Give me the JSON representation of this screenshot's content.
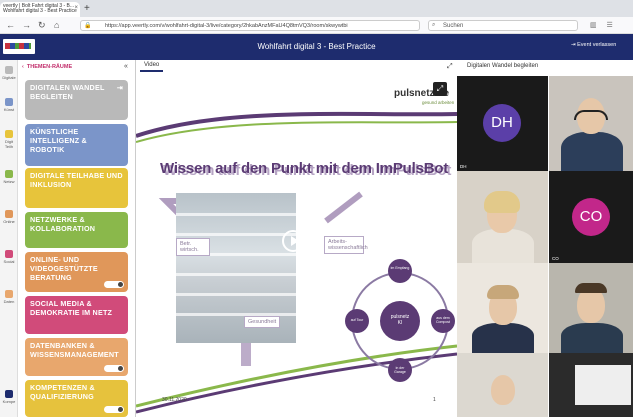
{
  "browser": {
    "tab_title": "veertly | Bolt Fahrt digital 3 - B... Wohlfahrt digital 3 - Best Practice",
    "tab_close": "×",
    "new_tab": "+",
    "url": "https://app.veertly.com/v/wohlfahrt-digital-3/live/category/2hkabAnzMFaU4Q8tmVQ3/room/skwywtbi",
    "search_placeholder": "Suchen"
  },
  "app": {
    "title": "Wohlfahrt digital 3 - Best Practice",
    "exit_label": "Event verlassen"
  },
  "sidebar": {
    "header": "THEMEN-RÄUME",
    "collapse": "«",
    "icon_items": [
      "Digitale",
      "Künst",
      "Digit Teilh",
      "Netzw",
      "Online",
      "Social",
      "Daten",
      "Kompe"
    ],
    "cards": [
      {
        "label": "DIGITALEN WANDEL BEGLEITEN",
        "color": "#b9b9b9"
      },
      {
        "label": "KÜNSTLICHE INTELLIGENZ & ROBOTIK",
        "color": "#7b95c9"
      },
      {
        "label": "DIGITALE TEILHABE UND INKLUSION",
        "color": "#e7c43b"
      },
      {
        "label": "NETZWERKE & KOLLABORATION",
        "color": "#8ab84b"
      },
      {
        "label": "ONLINE- UND VIDEOGESTÜTZTE BERATUNG",
        "color": "#e0975a"
      },
      {
        "label": "SOCIAL MEDIA & DEMOKRATIE IM NETZ",
        "color": "#d14b7a"
      },
      {
        "label": "DATENBANKEN & WISSENSMANAGEMENT",
        "color": "#e8a76d"
      },
      {
        "label": "KOMPETENZEN & QUALIFIZIERUNG",
        "color": "#e6c23d"
      }
    ]
  },
  "main": {
    "video_tab": "Video",
    "right_tab": "Digitalen Wandel begleiten"
  },
  "slide": {
    "title": "Wissen auf den Punkt mit dem ImPulsBot",
    "title_ghost": "Wissen auf den Punkt mit dem ImPulsBot",
    "logo": "pulsnetz.de",
    "logo_sub": "gesund arbeiten",
    "label_left": "Betr. wirtsch.",
    "label_right": "Arbeits- wissenschaftlich",
    "label_bottom": "Gesundheit",
    "center_node": "pulsnetz KI",
    "nodes": [
      "im Empfang",
      "aus dem Compost",
      "in der Garage",
      "auf Tour"
    ],
    "date": "30.11.2020",
    "page": "1"
  },
  "participants": [
    {
      "initials": "DH",
      "color": "#5b3fa8",
      "name": "DH"
    },
    {
      "initials": "CO",
      "color": "#c2278a",
      "name": "CO"
    }
  ]
}
